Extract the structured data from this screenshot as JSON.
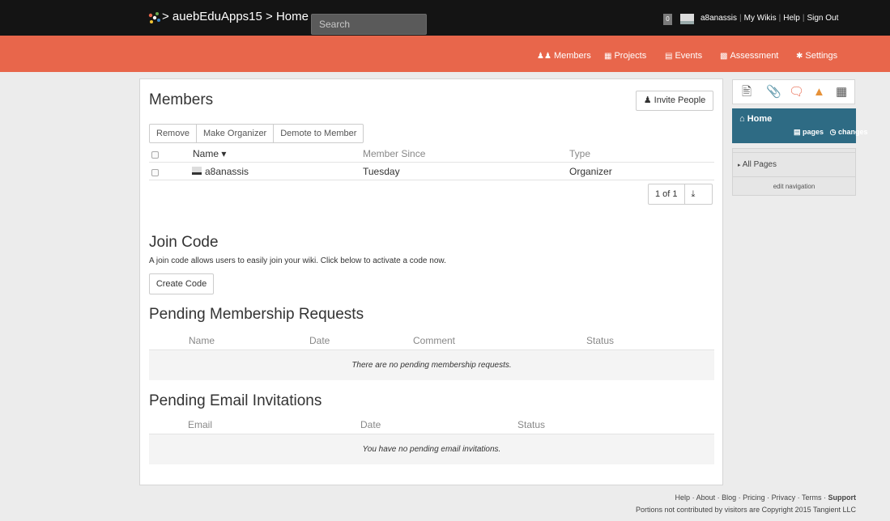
{
  "topbar": {
    "breadcrumb": "> auebEduApps15 > Home",
    "search_placeholder": "Search",
    "notification_count": "0",
    "username": "a8anassis",
    "links": [
      "My Wikis",
      "Help",
      "Sign Out"
    ]
  },
  "nav": [
    {
      "icon": "members-icon",
      "label": "Members"
    },
    {
      "icon": "projects-icon",
      "label": "Projects"
    },
    {
      "icon": "events-icon",
      "label": "Events"
    },
    {
      "icon": "assessment-icon",
      "label": "Assessment"
    },
    {
      "icon": "settings-icon",
      "label": "Settings"
    }
  ],
  "members": {
    "title": "Members",
    "invite_label": "Invite People",
    "actions": [
      "Remove",
      "Make Organizer",
      "Demote to Member"
    ],
    "columns": [
      "Name ▾",
      "Member Since",
      "Type"
    ],
    "rows": [
      {
        "name": "a8anassis",
        "since": "Tuesday",
        "type": "Organizer"
      }
    ],
    "pager": "1 of 1"
  },
  "join": {
    "title": "Join Code",
    "description": "A join code allows users to easily join your wiki. Click below to activate a code now.",
    "button": "Create Code"
  },
  "requests": {
    "title": "Pending Membership Requests",
    "columns": [
      "Name",
      "Date",
      "Comment",
      "Status"
    ],
    "empty": "There are no pending membership requests."
  },
  "invitations": {
    "title": "Pending Email Invitations",
    "columns": [
      "Email",
      "Date",
      "Status"
    ],
    "empty": "You have no pending email invitations."
  },
  "sidebar": {
    "icons": [
      "page-icon",
      "attachment-icon",
      "comment-icon",
      "sitemap-icon",
      "calendar-icon"
    ],
    "home_title": "Home",
    "home_pages": "pages",
    "home_changes": "changes",
    "all_pages": "All Pages",
    "edit_navigation": "edit navigation"
  },
  "footer": {
    "links": [
      "Help",
      "About",
      "Blog",
      "Pricing",
      "Privacy",
      "Terms",
      "Support"
    ],
    "copyright": "Portions not contributed by visitors are Copyright 2015 Tangient LLC"
  },
  "colors": {
    "nav_bar": "#e8664b",
    "top_bar": "#141414",
    "home_panel": "#2e6b84",
    "sidebar_icon_accent": "#e8664b",
    "attachment_icon": "#6aa84f"
  }
}
